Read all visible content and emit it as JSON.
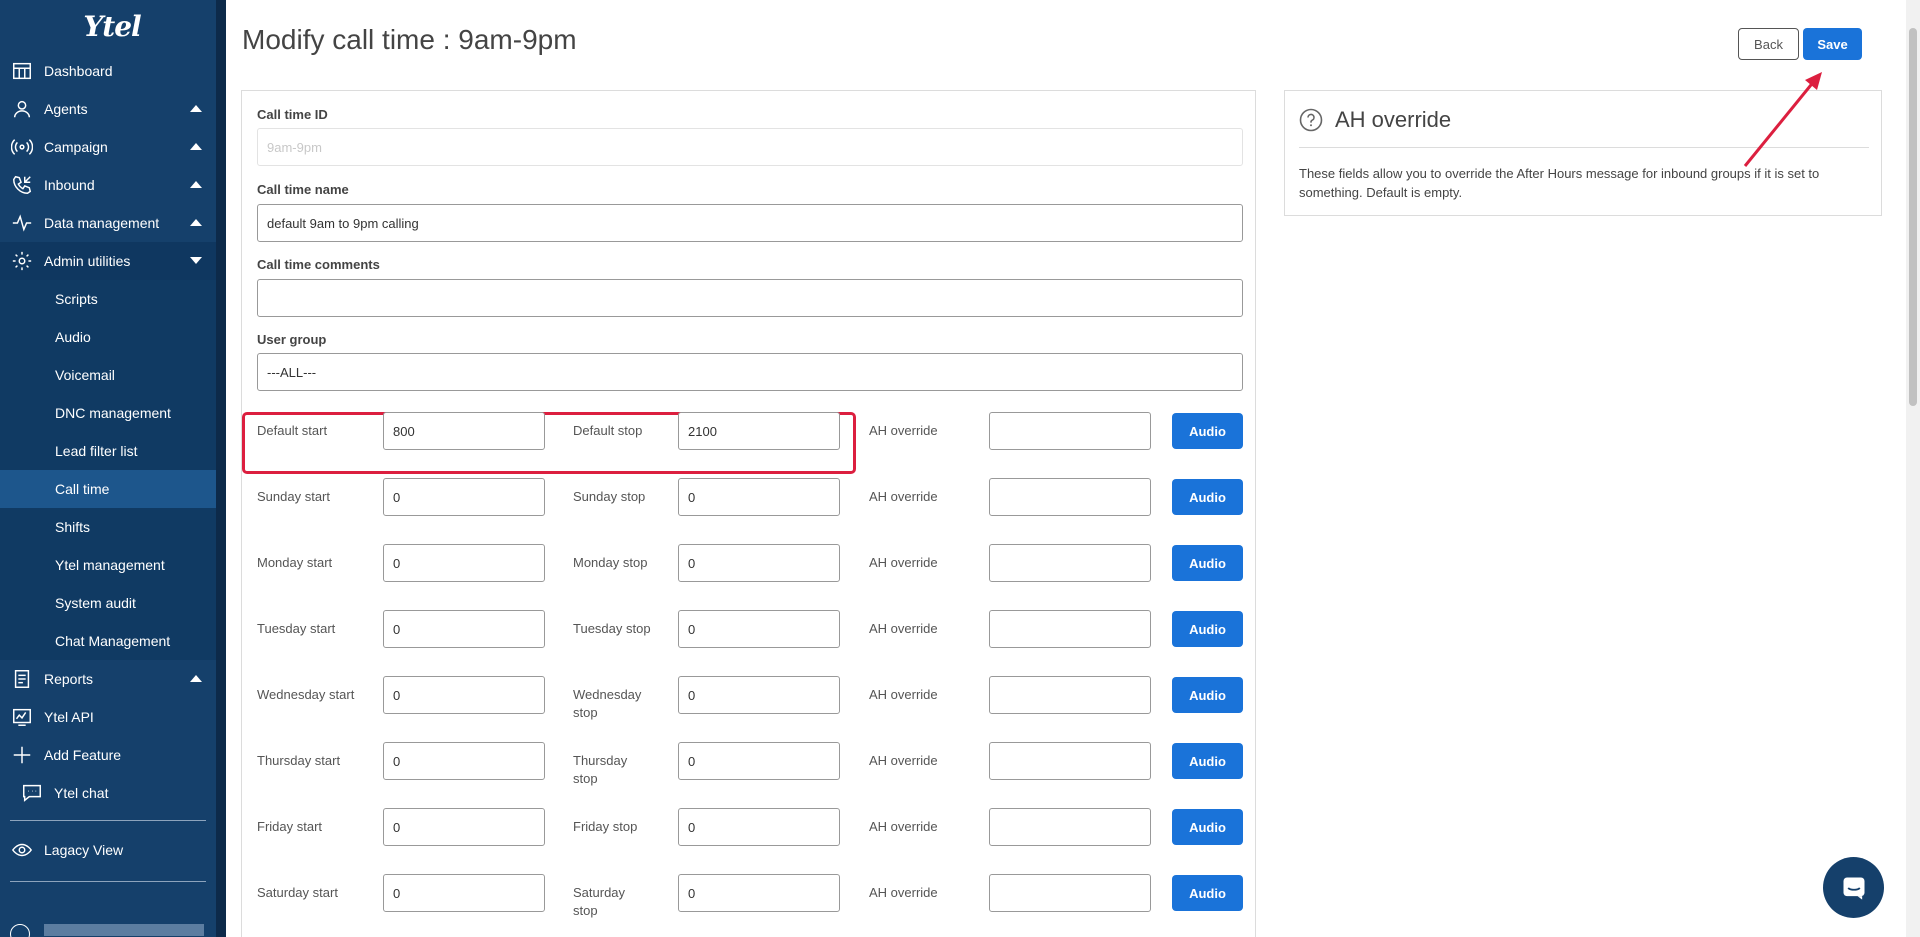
{
  "sidebar": {
    "logo": "Ytel",
    "items": [
      {
        "label": "Dashboard",
        "icon": "dashboard-icon",
        "caret": ""
      },
      {
        "label": "Agents",
        "icon": "agents-icon",
        "caret": "up"
      },
      {
        "label": "Campaign",
        "icon": "campaign-icon",
        "caret": "up"
      },
      {
        "label": "Inbound",
        "icon": "inbound-icon",
        "caret": "up"
      },
      {
        "label": "Data management",
        "icon": "data-management-icon",
        "caret": "up"
      },
      {
        "label": "Admin utilities",
        "icon": "gear-icon",
        "caret": "down"
      }
    ],
    "admin_sub_items": [
      "Scripts",
      "Audio",
      "Voicemail",
      "DNC management",
      "Lead filter list",
      "Call time",
      "Shifts",
      "Ytel management",
      "System audit",
      "Chat Management"
    ],
    "lower_items": [
      {
        "label": "Reports",
        "icon": "reports-icon",
        "caret": "up"
      },
      {
        "label": "Ytel API",
        "icon": "api-icon",
        "caret": ""
      },
      {
        "label": "Add Feature",
        "icon": "plus-icon",
        "caret": ""
      },
      {
        "label": "Ytel chat",
        "icon": "chat-icon",
        "caret": ""
      }
    ],
    "legacy_view": "Lagacy View"
  },
  "header": {
    "title": "Modify call time : 9am-9pm",
    "back_label": "Back",
    "save_label": "Save"
  },
  "form": {
    "call_time_id_label": "Call time ID",
    "call_time_id_value": "9am-9pm",
    "call_time_name_label": "Call time name",
    "call_time_name_value": "default 9am to 9pm calling",
    "comments_label": "Call time comments",
    "comments_value": "",
    "user_group_label": "User group",
    "user_group_value": "---ALL---",
    "ah_override_label": "AH override",
    "audio_label": "Audio",
    "rows": [
      {
        "start_label": "Default start",
        "start_value": "800",
        "stop_label": "Default stop",
        "stop_value": "2100"
      },
      {
        "start_label": "Sunday start",
        "start_value": "0",
        "stop_label": "Sunday stop",
        "stop_value": "0"
      },
      {
        "start_label": "Monday start",
        "start_value": "0",
        "stop_label": "Monday stop",
        "stop_value": "0"
      },
      {
        "start_label": "Tuesday start",
        "start_value": "0",
        "stop_label": "Tuesday stop",
        "stop_value": "0"
      },
      {
        "start_label": "Wednesday start",
        "start_value": "0",
        "stop_label": "Wednesday stop",
        "stop_value": "0"
      },
      {
        "start_label": "Thursday start",
        "start_value": "0",
        "stop_label": "Thursday stop",
        "stop_value": "0"
      },
      {
        "start_label": "Friday start",
        "start_value": "0",
        "stop_label": "Friday stop",
        "stop_value": "0"
      },
      {
        "start_label": "Saturday start",
        "start_value": "0",
        "stop_label": "Saturday stop",
        "stop_value": "0"
      }
    ]
  },
  "help": {
    "title": "AH override",
    "text": "These fields allow you to override the After Hours message for inbound groups if it is set to something. Default is empty."
  },
  "colors": {
    "sidebar_bg": "#15406b",
    "primary_button": "#1a73d9",
    "highlight": "#dc1f3f"
  }
}
